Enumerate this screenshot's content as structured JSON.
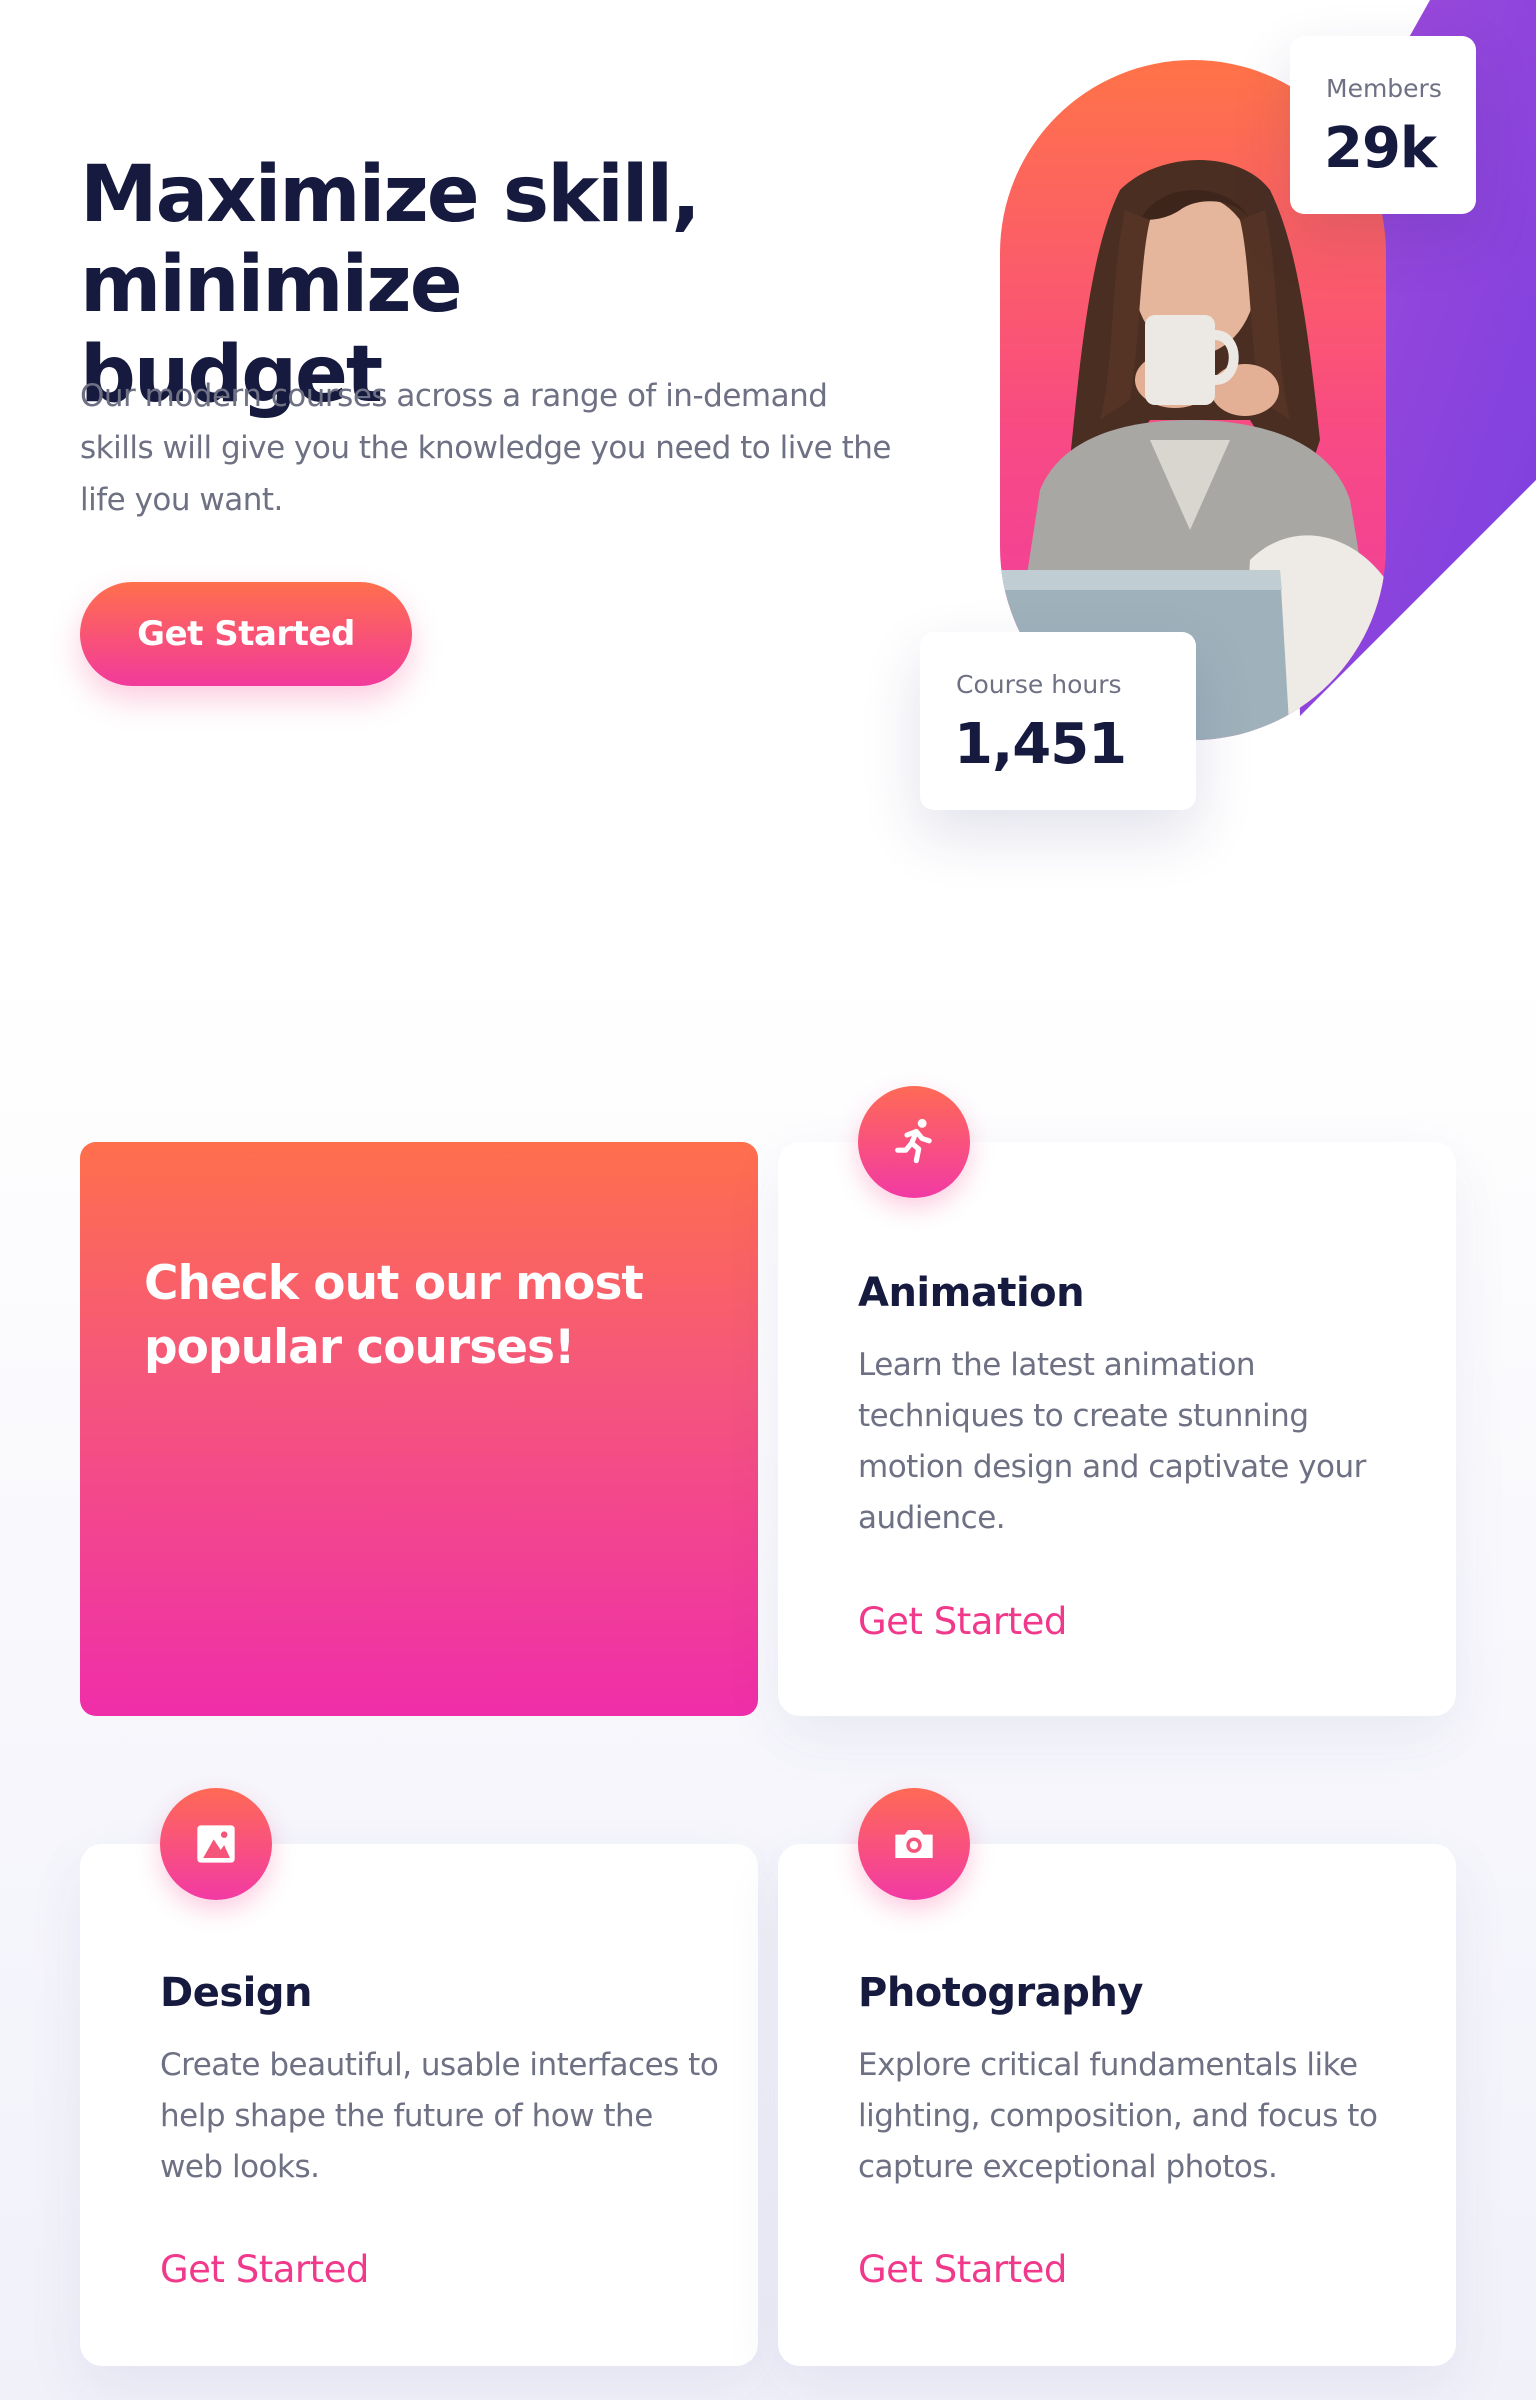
{
  "hero": {
    "title_line1": "Maximize skill,",
    "title_line2": "minimize budget",
    "subtitle": "Our modern courses across a range of in-demand skills will give you the knowledge you need to live the life you want.",
    "cta_label": "Get Started"
  },
  "stats": {
    "members": {
      "label": "Members",
      "value": "29k"
    },
    "hours": {
      "label": "Course hours",
      "value": "1,451"
    }
  },
  "courses": {
    "feature_title": "Check out our most popular courses!",
    "items": [
      {
        "title": "Animation",
        "icon": "running-person-icon",
        "description": "Learn the latest animation techniques to create stunning motion design and captivate your audience.",
        "link": "Get Started"
      },
      {
        "title": "Design",
        "icon": "image-icon",
        "description": "Create beautiful, usable interfaces to help shape the future of how the web looks.",
        "link": "Get Started"
      },
      {
        "title": "Photography",
        "icon": "camera-icon",
        "description": "Explore critical fundamentals like lighting, composition, and focus to capture exceptional photos.",
        "link": "Get Started"
      }
    ]
  },
  "colors": {
    "heading": "#171a3f",
    "body": "#6e7083",
    "accent_pink": "#f0398b",
    "gradient_orange": "#ff6f4c",
    "gradient_magenta": "#ef2ea9",
    "purple": "#7b3fe0"
  }
}
